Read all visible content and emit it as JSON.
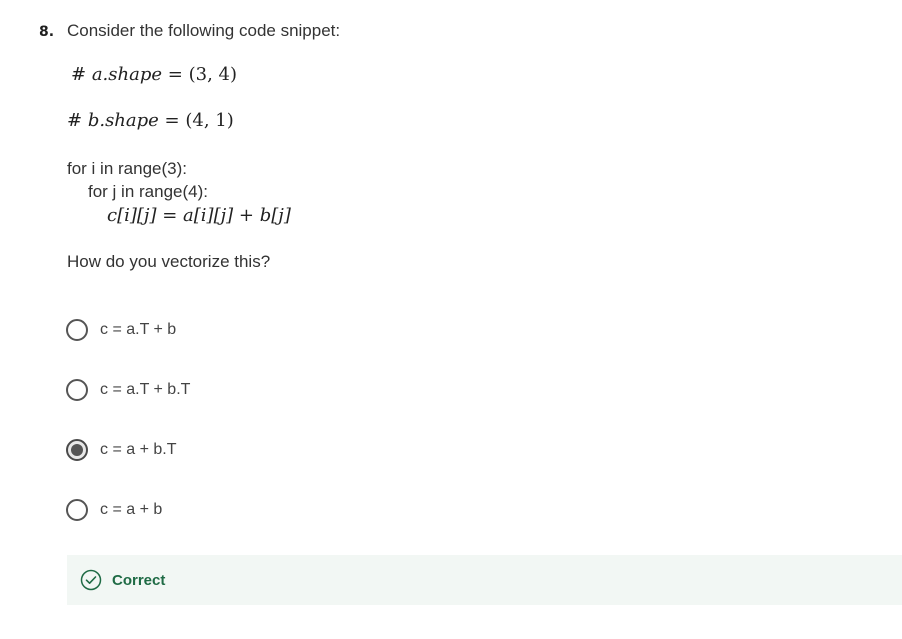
{
  "question": {
    "number": "8.",
    "prompt": "Consider the following code snippet:",
    "math_lines": [
      {
        "hash": "#",
        "lhs": "a.shape",
        "eq": "=",
        "rhs": "(3, 4)"
      },
      {
        "hash": "#",
        "lhs": "b.shape",
        "eq": "=",
        "rhs": "(4, 1)"
      }
    ],
    "code_lines": [
      "for i in range(3):",
      "for j in range(4):"
    ],
    "inner_math": "c[i][j] = a[i][j] + b[j]",
    "ask": "How do you vectorize this?"
  },
  "options": [
    {
      "label": "c = a.T + b",
      "selected": false
    },
    {
      "label": "c = a.T + b.T",
      "selected": false
    },
    {
      "label": "c = a + b.T",
      "selected": true
    },
    {
      "label": "c = a + b",
      "selected": false
    }
  ],
  "feedback": {
    "status": "Correct",
    "icon": "check-circle-icon",
    "color": "#1f6b45",
    "background": "#f2f7f4"
  }
}
